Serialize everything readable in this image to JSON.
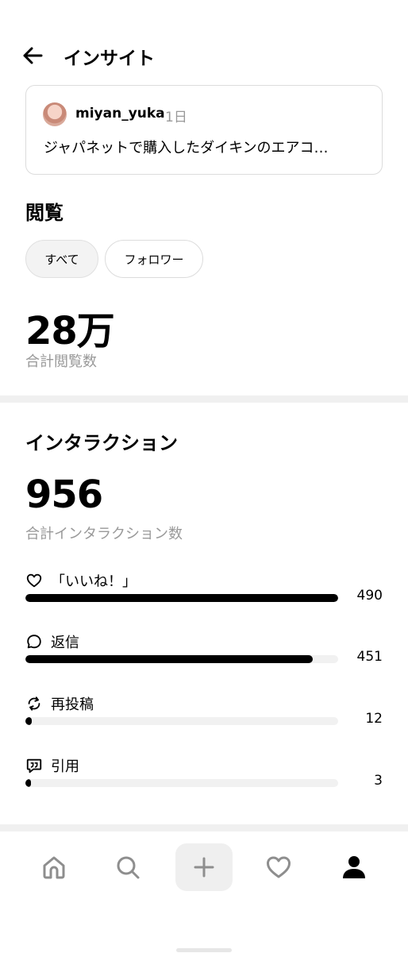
{
  "header": {
    "title": "インサイト",
    "back_icon": "arrow-left-icon"
  },
  "post": {
    "username": "miyan_yuka",
    "time": "1日",
    "text": "ジャパネットで購入したダイキンのエアコ…"
  },
  "views": {
    "title": "閲覧",
    "filters": [
      "すべて",
      "フォロワー"
    ],
    "selected_filter": "すべて",
    "total": "28万",
    "total_label": "合計閲覧数"
  },
  "interactions": {
    "title": "インタラクション",
    "total": "956",
    "total_label": "合計インタラクション数",
    "metrics": [
      {
        "label": "「いいね！」",
        "value": "490",
        "icon": "heart-icon",
        "fraction": 1.0
      },
      {
        "label": "返信",
        "value": "451",
        "icon": "speech-bubble-icon",
        "fraction": 0.92
      },
      {
        "label": "再投稿",
        "value": "12",
        "icon": "repost-icon",
        "fraction": 0.02
      },
      {
        "label": "引用",
        "value": "3",
        "icon": "quote-icon",
        "fraction": 0.005
      }
    ]
  },
  "nav": {
    "items": [
      "home-icon",
      "search-icon",
      "plus-icon",
      "heart-icon",
      "profile-icon"
    ],
    "active": "profile-icon",
    "colors": {
      "active": "#000000",
      "inactive": "#8e8e8e"
    }
  }
}
